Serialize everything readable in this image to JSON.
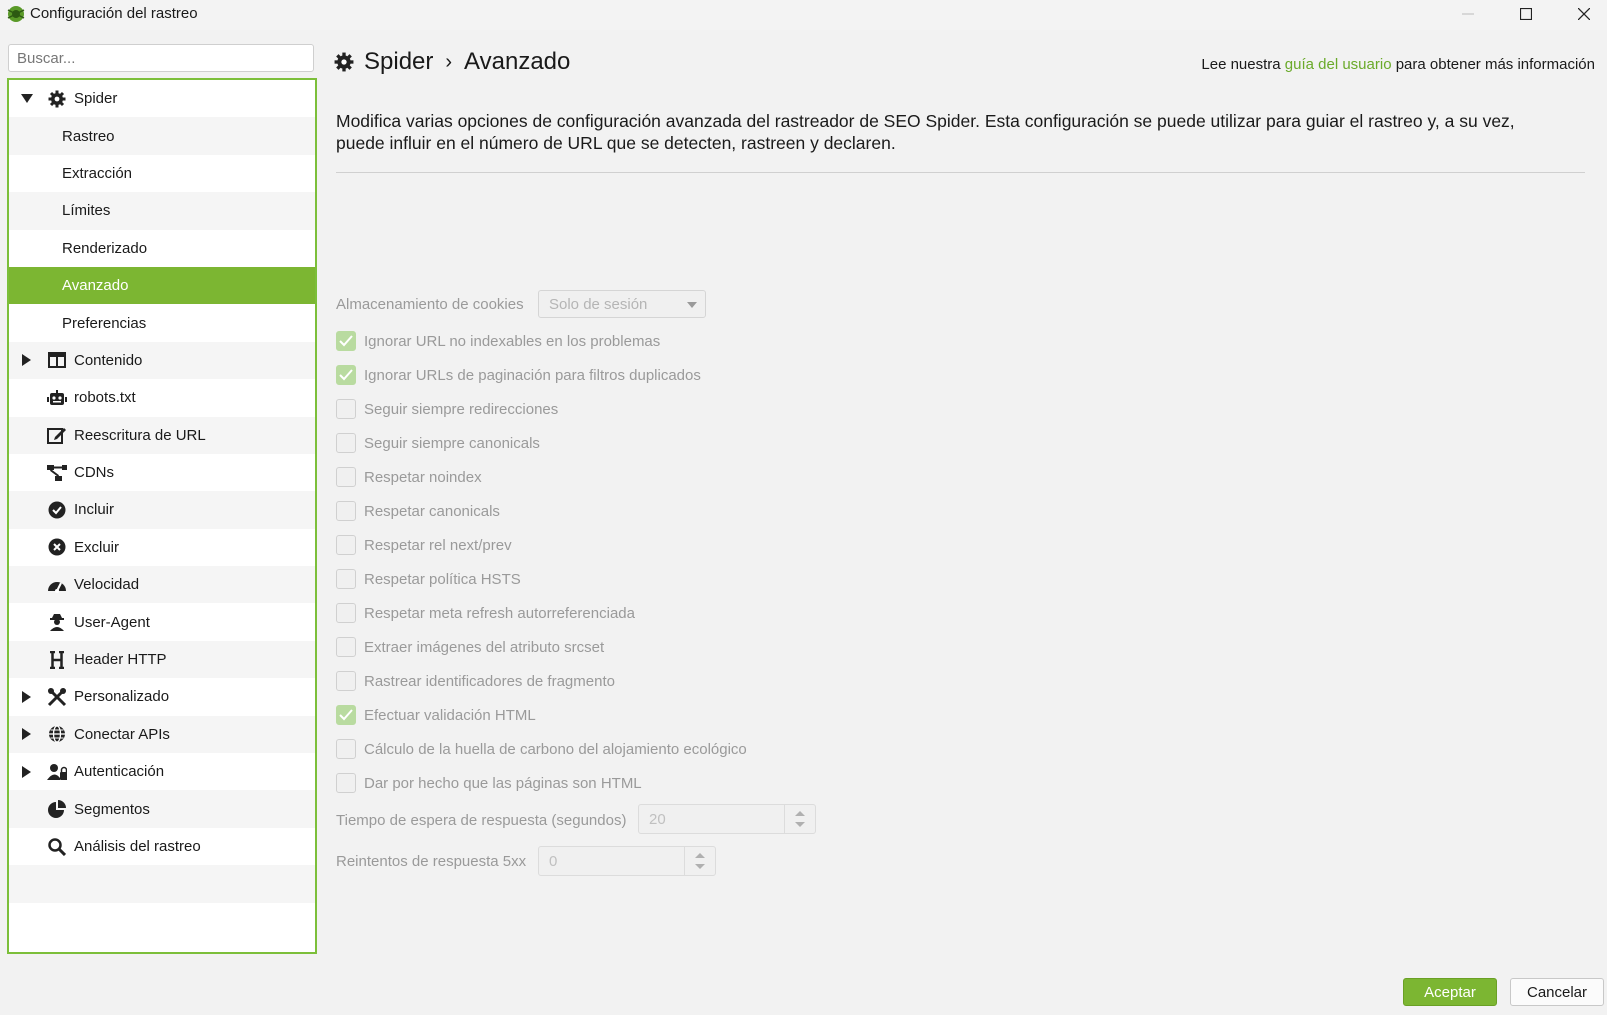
{
  "window": {
    "title": "Configuración del rastreo"
  },
  "sidebar": {
    "search_placeholder": "Buscar...",
    "items": [
      {
        "label": "Spider",
        "icon": "gear-icon",
        "expanded": true,
        "child": false
      },
      {
        "label": "Rastreo",
        "child": true
      },
      {
        "label": "Extracción",
        "child": true
      },
      {
        "label": "Límites",
        "child": true
      },
      {
        "label": "Renderizado",
        "child": true
      },
      {
        "label": "Avanzado",
        "child": true,
        "selected": true
      },
      {
        "label": "Preferencias",
        "child": true
      },
      {
        "label": "Contenido",
        "icon": "columns-icon",
        "collapsed": true
      },
      {
        "label": "robots.txt",
        "icon": "robot-icon"
      },
      {
        "label": "Reescritura de URL",
        "icon": "edit-icon"
      },
      {
        "label": "CDNs",
        "icon": "network-icon"
      },
      {
        "label": "Incluir",
        "icon": "check-circle-icon"
      },
      {
        "label": "Excluir",
        "icon": "x-circle-icon"
      },
      {
        "label": "Velocidad",
        "icon": "speedometer-icon"
      },
      {
        "label": "User-Agent",
        "icon": "user-secret-icon"
      },
      {
        "label": "Header HTTP",
        "icon": "heading-icon"
      },
      {
        "label": "Personalizado",
        "icon": "tools-icon",
        "collapsed": true
      },
      {
        "label": "Conectar APIs",
        "icon": "globe-icon",
        "collapsed": true
      },
      {
        "label": "Autenticación",
        "icon": "user-lock-icon",
        "collapsed": true
      },
      {
        "label": "Segmentos",
        "icon": "pie-chart-icon"
      },
      {
        "label": "Análisis del rastreo",
        "icon": "search-icon"
      }
    ]
  },
  "header": {
    "breadcrumb_root": "Spider",
    "breadcrumb_sep": "›",
    "breadcrumb_current": "Avanzado",
    "help_prefix": "Lee nuestra",
    "help_link": "guía del usuario",
    "help_suffix": "para obtener más información"
  },
  "main": {
    "description": "Modifica varias opciones de configuración avanzada del rastreador de SEO Spider. Esta configuración se puede utilizar para guiar el rastreo y, a su vez, puede influir en el número de URL que se detecten, rastreen y declaren.",
    "cookie_label": "Almacenamiento de cookies",
    "cookie_value": "Solo de sesión",
    "checkboxes": [
      {
        "label": "Ignorar URL no indexables en los problemas",
        "checked": true
      },
      {
        "label": "Ignorar URLs de paginación para filtros duplicados",
        "checked": true
      },
      {
        "label": "Seguir siempre redirecciones",
        "checked": false
      },
      {
        "label": "Seguir siempre canonicals",
        "checked": false
      },
      {
        "label": "Respetar noindex",
        "checked": false
      },
      {
        "label": "Respetar canonicals",
        "checked": false
      },
      {
        "label": "Respetar rel next/prev",
        "checked": false
      },
      {
        "label": "Respetar política HSTS",
        "checked": false
      },
      {
        "label": "Respetar meta refresh autorreferenciada",
        "checked": false
      },
      {
        "label": "Extraer imágenes del atributo srcset",
        "checked": false
      },
      {
        "label": "Rastrear identificadores de fragmento",
        "checked": false
      },
      {
        "label": "Efectuar validación HTML",
        "checked": true
      },
      {
        "label": "Cálculo de la huella de carbono del alojamiento ecológico",
        "checked": false
      },
      {
        "label": "Dar por hecho que las páginas son HTML",
        "checked": false
      }
    ],
    "timeout_label": "Tiempo de espera de respuesta (segundos)",
    "timeout_value": "20",
    "retries_label": "Reintentos de respuesta 5xx",
    "retries_value": "0"
  },
  "footer": {
    "ok_label": "Aceptar",
    "cancel_label": "Cancelar"
  },
  "colors": {
    "accent": "#7cb632",
    "link": "#6aaa2a",
    "border": "#7cbf3a"
  }
}
